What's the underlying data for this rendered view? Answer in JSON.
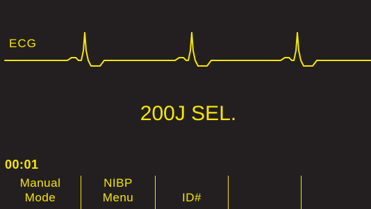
{
  "display": {
    "background_color": "#231f20",
    "trace_color": "#f5e600",
    "ecg_label": "ECG",
    "energy_selection": "200J SEL.",
    "elapsed_time": "00:01"
  },
  "softkeys": [
    {
      "line1": "Manual",
      "line2": "Mode"
    },
    {
      "line1": "NIBP",
      "line2": "Menu"
    },
    {
      "line1": "",
      "line2": "ID#"
    },
    {
      "line1": "",
      "line2": ""
    },
    {
      "line1": "",
      "line2": ""
    }
  ]
}
